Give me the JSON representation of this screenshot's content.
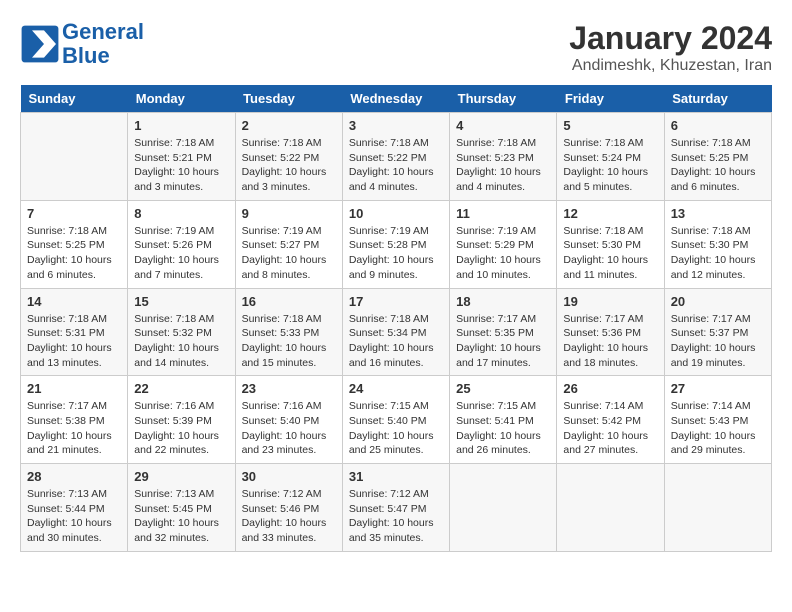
{
  "header": {
    "logo_line1": "General",
    "logo_line2": "Blue",
    "month": "January 2024",
    "location": "Andimeshk, Khuzestan, Iran"
  },
  "weekdays": [
    "Sunday",
    "Monday",
    "Tuesday",
    "Wednesday",
    "Thursday",
    "Friday",
    "Saturday"
  ],
  "weeks": [
    [
      {
        "day": "",
        "info": ""
      },
      {
        "day": "1",
        "info": "Sunrise: 7:18 AM\nSunset: 5:21 PM\nDaylight: 10 hours\nand 3 minutes."
      },
      {
        "day": "2",
        "info": "Sunrise: 7:18 AM\nSunset: 5:22 PM\nDaylight: 10 hours\nand 3 minutes."
      },
      {
        "day": "3",
        "info": "Sunrise: 7:18 AM\nSunset: 5:22 PM\nDaylight: 10 hours\nand 4 minutes."
      },
      {
        "day": "4",
        "info": "Sunrise: 7:18 AM\nSunset: 5:23 PM\nDaylight: 10 hours\nand 4 minutes."
      },
      {
        "day": "5",
        "info": "Sunrise: 7:18 AM\nSunset: 5:24 PM\nDaylight: 10 hours\nand 5 minutes."
      },
      {
        "day": "6",
        "info": "Sunrise: 7:18 AM\nSunset: 5:25 PM\nDaylight: 10 hours\nand 6 minutes."
      }
    ],
    [
      {
        "day": "7",
        "info": "Sunrise: 7:18 AM\nSunset: 5:25 PM\nDaylight: 10 hours\nand 6 minutes."
      },
      {
        "day": "8",
        "info": "Sunrise: 7:19 AM\nSunset: 5:26 PM\nDaylight: 10 hours\nand 7 minutes."
      },
      {
        "day": "9",
        "info": "Sunrise: 7:19 AM\nSunset: 5:27 PM\nDaylight: 10 hours\nand 8 minutes."
      },
      {
        "day": "10",
        "info": "Sunrise: 7:19 AM\nSunset: 5:28 PM\nDaylight: 10 hours\nand 9 minutes."
      },
      {
        "day": "11",
        "info": "Sunrise: 7:19 AM\nSunset: 5:29 PM\nDaylight: 10 hours\nand 10 minutes."
      },
      {
        "day": "12",
        "info": "Sunrise: 7:18 AM\nSunset: 5:30 PM\nDaylight: 10 hours\nand 11 minutes."
      },
      {
        "day": "13",
        "info": "Sunrise: 7:18 AM\nSunset: 5:30 PM\nDaylight: 10 hours\nand 12 minutes."
      }
    ],
    [
      {
        "day": "14",
        "info": "Sunrise: 7:18 AM\nSunset: 5:31 PM\nDaylight: 10 hours\nand 13 minutes."
      },
      {
        "day": "15",
        "info": "Sunrise: 7:18 AM\nSunset: 5:32 PM\nDaylight: 10 hours\nand 14 minutes."
      },
      {
        "day": "16",
        "info": "Sunrise: 7:18 AM\nSunset: 5:33 PM\nDaylight: 10 hours\nand 15 minutes."
      },
      {
        "day": "17",
        "info": "Sunrise: 7:18 AM\nSunset: 5:34 PM\nDaylight: 10 hours\nand 16 minutes."
      },
      {
        "day": "18",
        "info": "Sunrise: 7:17 AM\nSunset: 5:35 PM\nDaylight: 10 hours\nand 17 minutes."
      },
      {
        "day": "19",
        "info": "Sunrise: 7:17 AM\nSunset: 5:36 PM\nDaylight: 10 hours\nand 18 minutes."
      },
      {
        "day": "20",
        "info": "Sunrise: 7:17 AM\nSunset: 5:37 PM\nDaylight: 10 hours\nand 19 minutes."
      }
    ],
    [
      {
        "day": "21",
        "info": "Sunrise: 7:17 AM\nSunset: 5:38 PM\nDaylight: 10 hours\nand 21 minutes."
      },
      {
        "day": "22",
        "info": "Sunrise: 7:16 AM\nSunset: 5:39 PM\nDaylight: 10 hours\nand 22 minutes."
      },
      {
        "day": "23",
        "info": "Sunrise: 7:16 AM\nSunset: 5:40 PM\nDaylight: 10 hours\nand 23 minutes."
      },
      {
        "day": "24",
        "info": "Sunrise: 7:15 AM\nSunset: 5:40 PM\nDaylight: 10 hours\nand 25 minutes."
      },
      {
        "day": "25",
        "info": "Sunrise: 7:15 AM\nSunset: 5:41 PM\nDaylight: 10 hours\nand 26 minutes."
      },
      {
        "day": "26",
        "info": "Sunrise: 7:14 AM\nSunset: 5:42 PM\nDaylight: 10 hours\nand 27 minutes."
      },
      {
        "day": "27",
        "info": "Sunrise: 7:14 AM\nSunset: 5:43 PM\nDaylight: 10 hours\nand 29 minutes."
      }
    ],
    [
      {
        "day": "28",
        "info": "Sunrise: 7:13 AM\nSunset: 5:44 PM\nDaylight: 10 hours\nand 30 minutes."
      },
      {
        "day": "29",
        "info": "Sunrise: 7:13 AM\nSunset: 5:45 PM\nDaylight: 10 hours\nand 32 minutes."
      },
      {
        "day": "30",
        "info": "Sunrise: 7:12 AM\nSunset: 5:46 PM\nDaylight: 10 hours\nand 33 minutes."
      },
      {
        "day": "31",
        "info": "Sunrise: 7:12 AM\nSunset: 5:47 PM\nDaylight: 10 hours\nand 35 minutes."
      },
      {
        "day": "",
        "info": ""
      },
      {
        "day": "",
        "info": ""
      },
      {
        "day": "",
        "info": ""
      }
    ]
  ]
}
